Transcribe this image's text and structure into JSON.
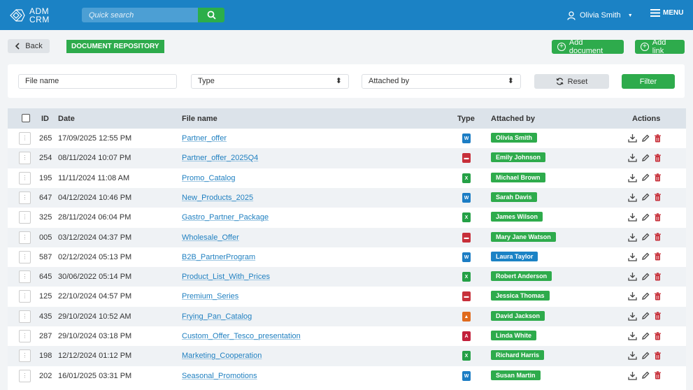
{
  "app": {
    "logo_line1": "ADM",
    "logo_line2": "CRM"
  },
  "search": {
    "placeholder": "Quick search"
  },
  "user": {
    "name": "Olivia Smith"
  },
  "menu": {
    "label": "MENU"
  },
  "toolbar": {
    "back_label": "Back",
    "page_title": "DOCUMENT REPOSITORY",
    "add_document_label": "Add document",
    "add_link_label": "Add link"
  },
  "filters": {
    "file_name_placeholder": "File name",
    "type_label": "Type",
    "attached_by_label": "Attached by",
    "reset_label": "Reset",
    "filter_label": "Filter"
  },
  "table": {
    "headers": {
      "id": "ID",
      "date": "Date",
      "file_name": "File name",
      "type": "Type",
      "attached_by": "Attached by",
      "actions": "Actions"
    },
    "rows": [
      {
        "id": "265",
        "date": "17/09/2025 12:55 PM",
        "file": "Partner_offer",
        "type": "w",
        "user": "Olivia Smith",
        "tag": "green"
      },
      {
        "id": "254",
        "date": "08/11/2024 10:07 PM",
        "file": "Partner_offer_2025Q4",
        "type": "p",
        "user": "Emily Johnson",
        "tag": "green"
      },
      {
        "id": "195",
        "date": "11/11/2024 11:08 AM",
        "file": "Promo_Catalog",
        "type": "x",
        "user": "Michael Brown",
        "tag": "green"
      },
      {
        "id": "647",
        "date": "04/12/2024 10:46 PM",
        "file": "New_Products_2025",
        "type": "w",
        "user": "Sarah Davis",
        "tag": "green"
      },
      {
        "id": "325",
        "date": "28/11/2024 06:04 PM",
        "file": "Gastro_Partner_Package",
        "type": "x",
        "user": "James Wilson",
        "tag": "green"
      },
      {
        "id": "005",
        "date": "03/12/2024 04:37 PM",
        "file": "Wholesale_Offer",
        "type": "p",
        "user": "Mary Jane Watson",
        "tag": "green"
      },
      {
        "id": "587",
        "date": "02/12/2024 05:13 PM",
        "file": "B2B_PartnerProgram",
        "type": "w",
        "user": "Laura Taylor",
        "tag": "blue"
      },
      {
        "id": "645",
        "date": "30/06/2022 05:14 PM",
        "file": "Product_List_With_Prices",
        "type": "x",
        "user": "Robert Anderson",
        "tag": "green"
      },
      {
        "id": "125",
        "date": "22/10/2024 04:57 PM",
        "file": "Premium_Series",
        "type": "p",
        "user": "Jessica Thomas",
        "tag": "green"
      },
      {
        "id": "435",
        "date": "29/10/2024 10:52 AM",
        "file": "Frying_Pan_Catalog",
        "type": "i",
        "user": "David Jackson",
        "tag": "green"
      },
      {
        "id": "287",
        "date": "29/10/2024 03:18 PM",
        "file": "Custom_Offer_Tesco_presentation",
        "type": "a",
        "user": "Linda White",
        "tag": "green"
      },
      {
        "id": "198",
        "date": "12/12/2024 01:12 PM",
        "file": "Marketing_Cooperation",
        "type": "x",
        "user": "Richard Harris",
        "tag": "green"
      },
      {
        "id": "202",
        "date": "16/01/2025 03:31 PM",
        "file": "Seasonal_Promotions",
        "type": "w",
        "user": "Susan Martin",
        "tag": "green"
      }
    ]
  },
  "icons": {
    "file_type_glyphs": {
      "w": "W",
      "x": "X",
      "p": "PDF",
      "i": "▲",
      "a": "A"
    }
  }
}
